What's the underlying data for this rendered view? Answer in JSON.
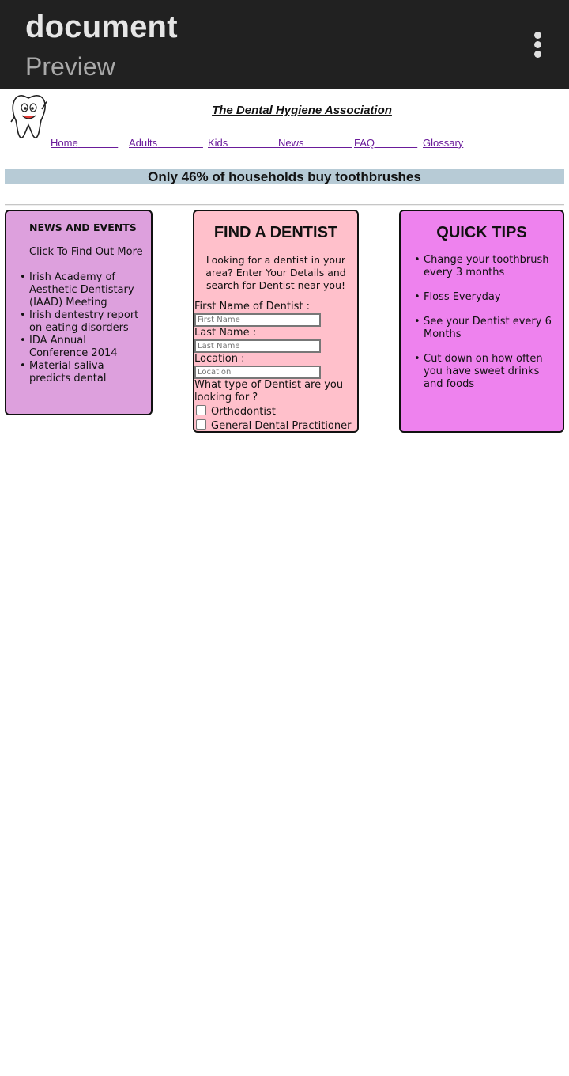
{
  "appbar": {
    "title": "document",
    "subtitle": "Preview",
    "menu_icon": "more-vert-icon"
  },
  "site": {
    "title": "The Dental Hygiene Association",
    "logo_icon": "tooth-mascot-icon"
  },
  "nav": {
    "home": "Home",
    "adults": "Adults",
    "kids": "Kids",
    "news": "News",
    "faq": "FAQ",
    "glossary": "Glossary"
  },
  "banner": "Only 46% of households buy toothbrushes",
  "news_box": {
    "heading": "NEWS AND EVENTS",
    "more": "Click To Find Out More",
    "items": [
      "Irish Academy of Aesthetic Dentistary (IAAD) Meeting",
      "Irish dentestry report on eating disorders",
      "IDA Annual Conference 2014",
      "Material saliva predicts dental"
    ],
    "color": "#dda0dd"
  },
  "find_dentist": {
    "heading": "FIND A DENTIST",
    "intro": "Looking for a dentist in your area? Enter Your Details and search for Dentist near you!",
    "first_name_label": "First Name of Dentist :",
    "first_name_placeholder": "First Name",
    "last_name_label": "Last Name :",
    "last_name_placeholder": "Last Name",
    "location_label": "Location :",
    "location_placeholder": "Location",
    "type_label": "What type of Dentist are you looking for ?",
    "option_1": "Orthodontist",
    "option_2": "General Dental Practitioner",
    "color": "#ffc0cb"
  },
  "quick_tips": {
    "heading": "QUICK TIPS",
    "items": [
      "Change your toothbrush every 3 months",
      "Floss Everyday",
      "See your Dentist every 6 Months",
      "Cut down on how often you have sweet drinks and foods"
    ],
    "color": "#ee82ee"
  }
}
